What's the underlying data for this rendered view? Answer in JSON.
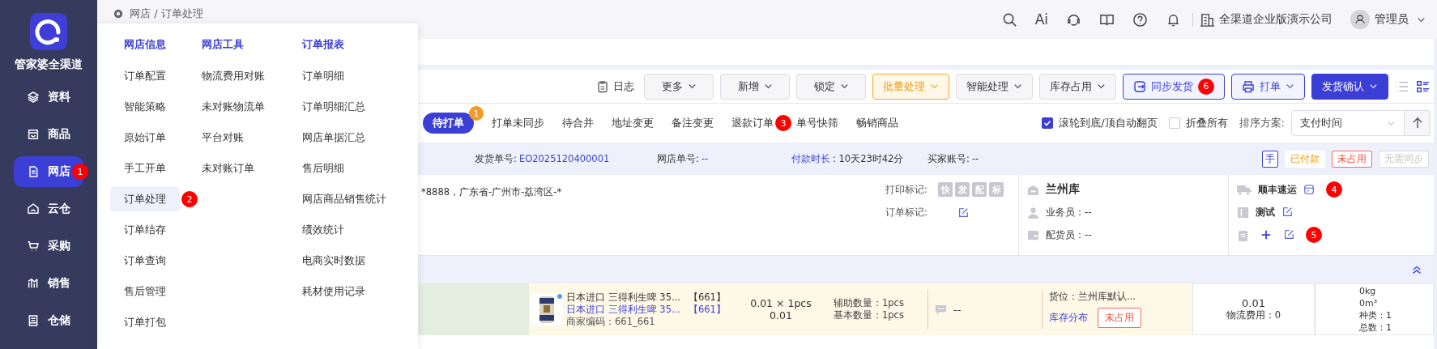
{
  "sidebar": {
    "brand": "管家婆全渠道",
    "items": [
      {
        "label": "资料",
        "selected": false
      },
      {
        "label": "商品",
        "selected": false
      },
      {
        "label": "网店",
        "selected": true,
        "marker": "1"
      },
      {
        "label": "云仓",
        "selected": false
      },
      {
        "label": "采购",
        "selected": false
      },
      {
        "label": "销售",
        "selected": false
      },
      {
        "label": "仓储",
        "selected": false
      }
    ]
  },
  "breadcrumb": "网店 / 订单处理",
  "header": {
    "ai_label": "Ai",
    "company": "全渠道企业版演示公司",
    "user": "管理员"
  },
  "menu": {
    "columns": [
      {
        "title": "网店信息",
        "items": [
          {
            "label": "订单配置",
            "selected": false
          },
          {
            "label": "智能策略",
            "selected": false
          },
          {
            "label": "原始订单",
            "selected": false
          },
          {
            "label": "手工开单",
            "selected": false
          },
          {
            "label": "订单处理",
            "selected": true,
            "marker": "2"
          },
          {
            "label": "订单结存",
            "selected": false
          },
          {
            "label": "订单查询",
            "selected": false
          },
          {
            "label": "售后管理",
            "selected": false
          },
          {
            "label": "订单打包",
            "selected": false
          }
        ]
      },
      {
        "title": "网店工具",
        "items": [
          {
            "label": "物流费用对账",
            "selected": false
          },
          {
            "label": "未对账物流单",
            "selected": false
          },
          {
            "label": "平台对账",
            "selected": false
          },
          {
            "label": "未对账订单",
            "selected": false
          }
        ]
      },
      {
        "title": "订单报表",
        "items": [
          {
            "label": "订单明细",
            "selected": false
          },
          {
            "label": "订单明细汇总",
            "selected": false
          },
          {
            "label": "网店单据汇总",
            "selected": false
          },
          {
            "label": "售后明细",
            "selected": false
          },
          {
            "label": "网店商品销售统计",
            "selected": false
          },
          {
            "label": "绩效统计",
            "selected": false
          },
          {
            "label": "电商实时数据",
            "selected": false
          },
          {
            "label": "耗材使用记录",
            "selected": false
          }
        ]
      }
    ]
  },
  "toolbar": {
    "log": "日志",
    "buttons": [
      {
        "label": "更多",
        "kind": "dropdown"
      },
      {
        "label": "新增",
        "kind": "dropdown"
      },
      {
        "label": "锁定",
        "kind": "dropdown"
      },
      {
        "label": "批量处理",
        "kind": "warning"
      },
      {
        "label": "智能处理",
        "kind": "dropdown"
      },
      {
        "label": "库存占用",
        "kind": "dropdown"
      },
      {
        "label": "同步发货",
        "kind": "sync",
        "marker": "6"
      },
      {
        "label": "打单",
        "kind": "print"
      },
      {
        "label": "发货确认",
        "kind": "primary"
      }
    ],
    "view_modes": [
      {
        "selected": false
      },
      {
        "selected": true
      }
    ]
  },
  "filter_tabs": [
    {
      "label": "待打单",
      "selected": true,
      "count": "1"
    },
    {
      "label": "打单未同步",
      "selected": false
    },
    {
      "label": "待合并",
      "selected": false
    },
    {
      "label": "地址变更",
      "selected": false
    },
    {
      "label": "备注变更",
      "selected": false
    },
    {
      "label": "退款订单",
      "selected": false,
      "marker": "3"
    },
    {
      "label": "单号快筛",
      "selected": false
    },
    {
      "label": "畅销商品",
      "selected": false
    }
  ],
  "options": [
    {
      "label": "滚轮到底/顶自动翻页",
      "checked": true
    },
    {
      "label": "折叠所有",
      "checked": false
    }
  ],
  "sort": {
    "label": "排序方案:",
    "value": "支付时间"
  },
  "order": {
    "fields": [
      {
        "label": "发货单号:",
        "value": "EO2025120400001",
        "kind": "link-value"
      },
      {
        "label": "网店单号:",
        "value": "--",
        "kind": "link-value"
      },
      {
        "label": "付款时长",
        "value": ": 10天23时42分",
        "kind": "link-label"
      },
      {
        "label": "买家账号:",
        "value": "--",
        "kind": "plain"
      }
    ],
    "tags": [
      {
        "label": "手",
        "kind": "mark"
      },
      {
        "label": "已付款",
        "kind": "paid"
      },
      {
        "label": "未占用",
        "kind": "danger"
      },
      {
        "label": "无需同步",
        "kind": "muted"
      }
    ],
    "address": "*8888，广东省-广州市-荔湾区-*",
    "print_marks": {
      "label": "打印标记:",
      "chips": [
        "快",
        "发",
        "配",
        "标"
      ]
    },
    "order_mark_label": "订单标记:",
    "warehouse": {
      "name": "兰州库",
      "people": [
        "业务员：--",
        "配货员：--"
      ]
    },
    "logistics": {
      "carrier": "顺丰速运",
      "carrier_marker": "4",
      "note": "测试",
      "remark_marker": "5"
    },
    "item": {
      "name": "日本进口 三得利生啤 35...",
      "code": "【661】",
      "name_link": "日本进口 三得利生啤 35...",
      "code_link": "【661】",
      "merchant_code": "商家编码：661_661",
      "price_qty": "0.01 × 1pcs",
      "amount": "0.01",
      "aux_qty": "辅助数量：1pcs",
      "base_qty": "基本数量：1pcs",
      "remark": "--",
      "location": "货位：兰州库默认...",
      "stock_link": "库存分布",
      "stock_status": "未占用",
      "freight_total": "0.01",
      "freight": "物流费用：0",
      "weight": "0kg",
      "volume": "0m³",
      "kinds": "种类：1",
      "total": "总数：1"
    }
  }
}
